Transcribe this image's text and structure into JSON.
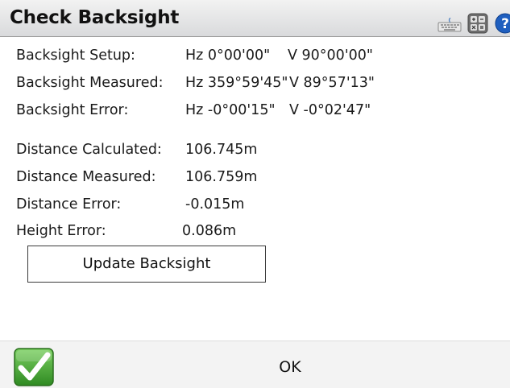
{
  "window": {
    "title": "Check Backsight"
  },
  "toolbar_icons": [
    "keyboard-icon",
    "calculator-icon",
    "help-icon"
  ],
  "backsight": {
    "setup": {
      "label": "Backsight Setup:",
      "hz": "Hz 0°00'00\"",
      "v": "V 90°00'00\""
    },
    "measured": {
      "label": "Backsight Measured:",
      "hz": "Hz 359°59'45\"",
      "v": "V 89°57'13\""
    },
    "error": {
      "label": "Backsight Error:",
      "hz": "Hz -0°00'15\"",
      "v": "V -0°02'47\""
    }
  },
  "distance": {
    "calculated": {
      "label": "Distance Calculated:",
      "value": "106.745m"
    },
    "measured": {
      "label": "Distance Measured:",
      "value": "106.759m"
    },
    "error": {
      "label": "Distance Error:",
      "value": "-0.015m"
    }
  },
  "height": {
    "error": {
      "label": "Height Error:",
      "value": "0.086m"
    }
  },
  "buttons": {
    "update_backsight": "Update Backsight",
    "ok": "OK",
    "accept_icon": "green-checkmark-icon"
  },
  "colors": {
    "titlebar": "#d9dadc",
    "check_green": "#3d9a2c",
    "help_blue": "#1f5fbf"
  }
}
